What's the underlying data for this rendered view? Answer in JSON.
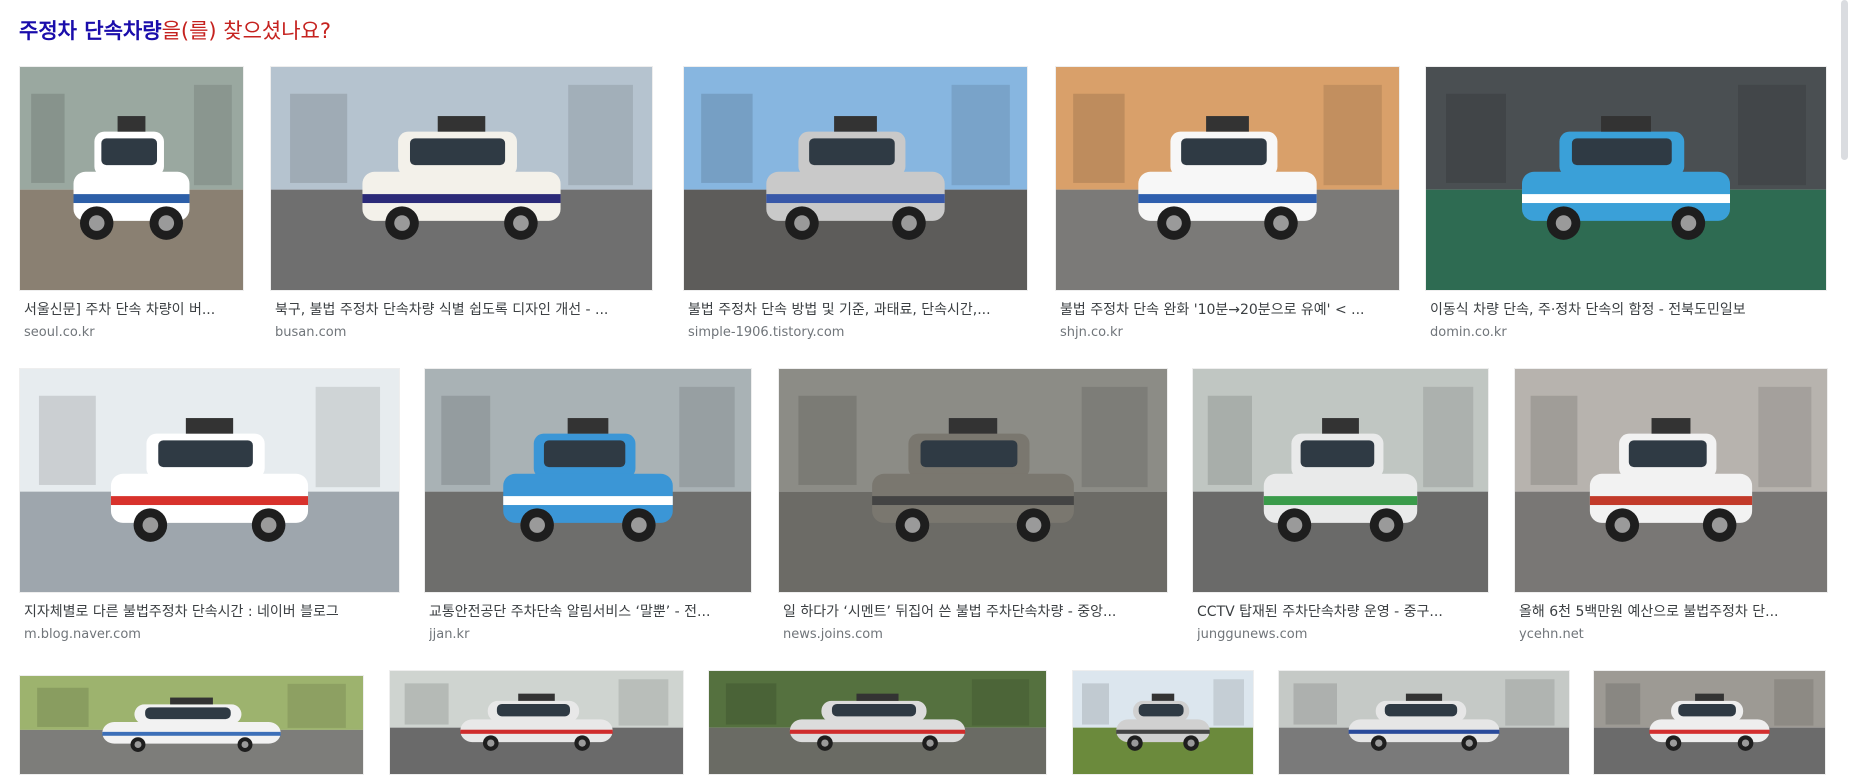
{
  "header": {
    "query": "주정차 단속차량",
    "suffix": "을(를) 찾으셨나요?"
  },
  "results": [
    {
      "title": "서울신문] 주차 단속 차량이 버...",
      "domain": "seoul.co.kr",
      "sky": "#9aa8a0",
      "ground": "#8a8072",
      "car": "#ffffff",
      "accent": "#2d5fa8"
    },
    {
      "title": "북구, 불법 주정차 단속차량 식별 쉽도록 디자인 개선 - ...",
      "domain": "busan.com",
      "sky": "#b5c3cf",
      "ground": "#6f6f6f",
      "car": "#f3f1ea",
      "accent": "#2b2a78"
    },
    {
      "title": "불법 주정차 단속 방법 및 기준, 과태료, 단속시간,...",
      "domain": "simple-1906.tistory.com",
      "sky": "#87b6e0",
      "ground": "#5d5c5a",
      "car": "#c9c9c9",
      "accent": "#3858a8"
    },
    {
      "title": "불법 주정차 단속 완화 '10분→20분으로 유예' < ...",
      "domain": "shjn.co.kr",
      "sky": "#d9a06a",
      "ground": "#7b7a78",
      "car": "#f7f7f7",
      "accent": "#2f5fae"
    },
    {
      "title": "이동식 차량 단속, 주·정차 단속의 함정 - 전북도민일보",
      "domain": "domin.co.kr",
      "sky": "#4a4f52",
      "ground": "#2e6b52",
      "car": "#3aa0d8",
      "accent": "#ffffff"
    },
    {
      "title": "지자체별로 다른 불법주정차 단속시간 : 네이버 블로그",
      "domain": "m.blog.naver.com",
      "sky": "#e7ecef",
      "ground": "#9ea6ad",
      "car": "#ffffff",
      "accent": "#d8322c"
    },
    {
      "title": "교통안전공단 주차단속 알림서비스 ‘말뿐’ - 전...",
      "domain": "jjan.kr",
      "sky": "#a9b2b5",
      "ground": "#6e6e6c",
      "car": "#3b96d6",
      "accent": "#ffffff"
    },
    {
      "title": "일 하다가 ‘시멘트’ 뒤집어 쓴 불법 주차단속차량 - 중앙...",
      "domain": "news.joins.com",
      "sky": "#8c8c86",
      "ground": "#6c6b66",
      "car": "#7a776f",
      "accent": "#444444"
    },
    {
      "title": "CCTV 탑재된 주차단속차량 운영 - 중구...",
      "domain": "junggunews.com",
      "sky": "#c0c6c2",
      "ground": "#6a6a69",
      "car": "#e9eaea",
      "accent": "#3a9b4a"
    },
    {
      "title": "올해 6천 5백만원 예산으로 불법주정차 단...",
      "domain": "ycehn.net",
      "sky": "#b7b3ae",
      "ground": "#797775",
      "car": "#f2f2f2",
      "accent": "#c23a2a"
    },
    {
      "title": "",
      "domain": "",
      "sky": "#9db36e",
      "ground": "#7d7d7a",
      "car": "#f2f2f2",
      "accent": "#3c6fb8"
    },
    {
      "title": "",
      "domain": "",
      "sky": "#cfd4d0",
      "ground": "#6a6a6a",
      "car": "#e8e8e8",
      "accent": "#cf2c2c"
    },
    {
      "title": "",
      "domain": "",
      "sky": "#55713f",
      "ground": "#6a6b64",
      "car": "#dcdcdc",
      "accent": "#cf2c2c"
    },
    {
      "title": "",
      "domain": "",
      "sky": "#dce6ee",
      "ground": "#6b8a3c",
      "car": "#d0d0d0",
      "accent": "#444444"
    },
    {
      "title": "",
      "domain": "",
      "sky": "#c5c9c6",
      "ground": "#7a7a7a",
      "car": "#e6e6e6",
      "accent": "#2a4b9b"
    },
    {
      "title": "",
      "domain": "",
      "sky": "#9d9a94",
      "ground": "#6b6b6b",
      "car": "#eeeeee",
      "accent": "#d32f2f"
    }
  ]
}
